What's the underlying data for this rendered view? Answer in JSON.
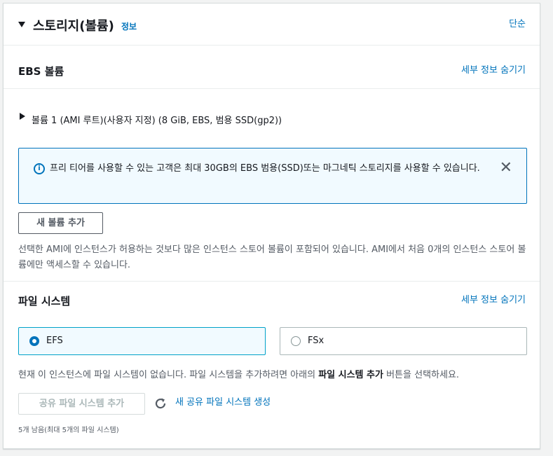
{
  "header": {
    "title": "스토리지(볼륨)",
    "info_link": "정보",
    "simple_link": "단순"
  },
  "ebs": {
    "title": "EBS 볼륨",
    "hide_details": "세부 정보 숨기기",
    "volume_label": "볼륨 1 (AMI 루트)(사용자 지정) (8 GiB, EBS, 범용 SSD(gp2))"
  },
  "alert": {
    "text": "프리 티어를 사용할 수 있는 고객은 최대 30GB의 EBS 범용(SSD)또는 마그네틱 스토리지를 사용할 수 있습니다.",
    "icon": "info-icon",
    "close_icon": "close-icon"
  },
  "add_volume_button": "새 볼륨 추가",
  "instance_store_desc": "선택한 AMI에 인스턴스가 허용하는 것보다 많은 인스턴스 스토어 볼륨이 포함되어 있습니다. AMI에서 처음 0개의 인스턴스 스토어 볼륨에만 액세스할 수 있습니다.",
  "file_systems": {
    "title": "파일 시스템",
    "hide_details": "세부 정보 숨기기",
    "options": [
      {
        "label": "EFS",
        "selected": true
      },
      {
        "label": "FSx",
        "selected": false
      }
    ],
    "desc_prefix": "현재 이 인스턴스에 파일 시스템이 없습니다. 파일 시스템을 추가하려면 아래의 ",
    "desc_bold": "파일 시스템 추가",
    "desc_suffix": " 버튼을 선택하세요.",
    "add_shared_button": "공유 파일 시스템 추가",
    "refresh_icon": "refresh-icon",
    "create_new_link": "새 공유 파일 시스템 생성",
    "remaining": "5개 남음(최대 5개의 파일 시스템)"
  },
  "colors": {
    "link": "#0073bb",
    "alert_bg": "#f1faff",
    "selected_border": "#00a1c9"
  }
}
